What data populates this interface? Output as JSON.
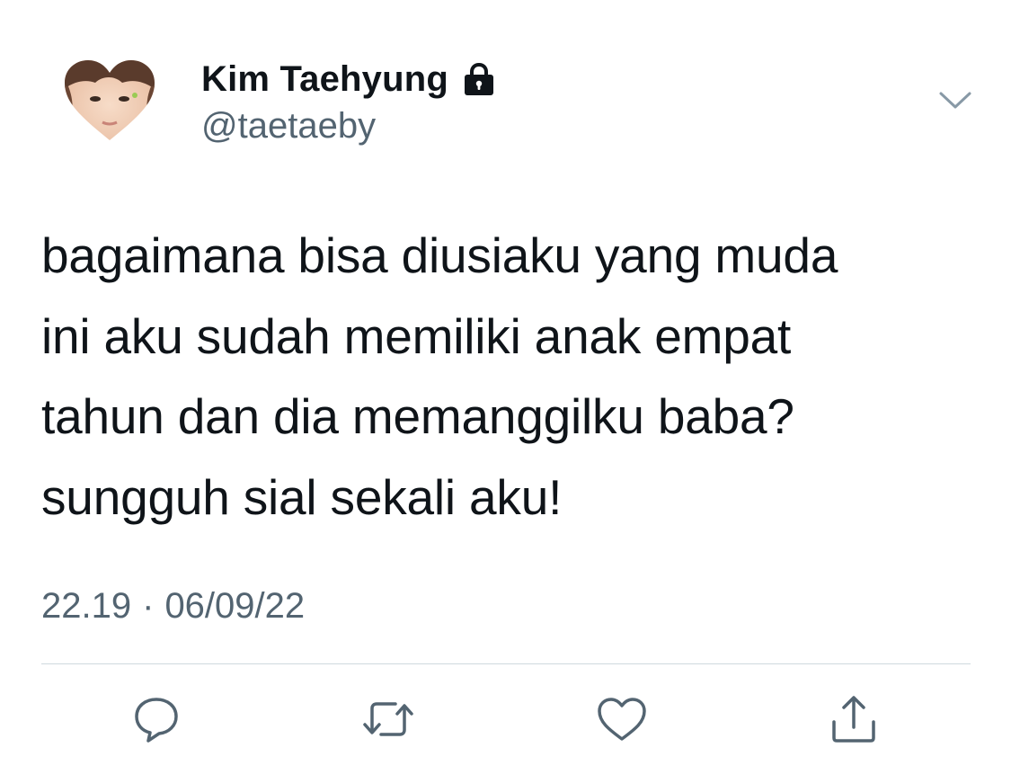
{
  "tweet": {
    "author": {
      "display_name": "Kim Taehyung",
      "handle": "@taetaeby",
      "avatar_icon": "heart-avatar",
      "protected_icon": "lock-icon"
    },
    "text": "bagaimana bisa diusiaku yang muda\nini aku sudah memiliki anak empat\ntahun dan dia memanggilku baba?\nsungguh sial sekali aku!",
    "time": "22.19",
    "separator": "·",
    "date": "06/09/22",
    "menu_icon": "chevron-down-icon",
    "actions": [
      {
        "icon": "reply-icon"
      },
      {
        "icon": "retweet-icon"
      },
      {
        "icon": "like-icon"
      },
      {
        "icon": "share-icon"
      }
    ]
  },
  "colors": {
    "text_primary": "#0f1419",
    "text_secondary": "#536471",
    "icon": "#536471",
    "divider": "#cfd9de",
    "background": "#ffffff"
  }
}
